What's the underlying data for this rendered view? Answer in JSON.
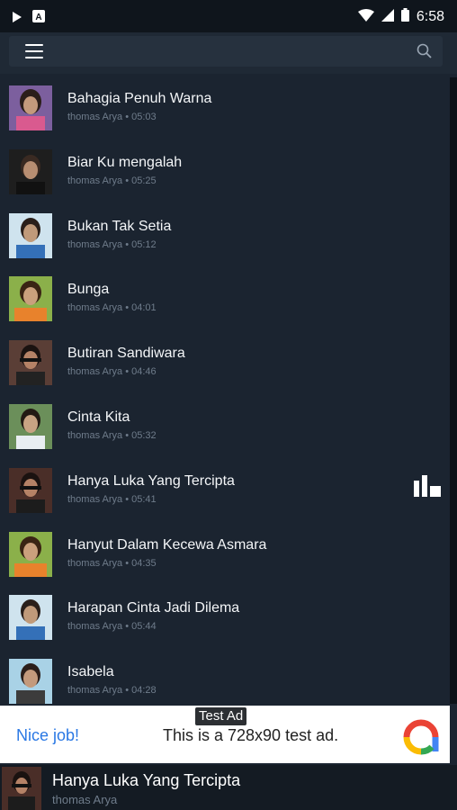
{
  "status_bar": {
    "time": "6:58",
    "left_icons": [
      "play-icon",
      "a-app-icon"
    ],
    "right_icons": [
      "wifi-icon",
      "signal-icon",
      "battery-icon"
    ]
  },
  "app_bar": {
    "menu_icon": "hamburger-menu-icon",
    "search_icon": "search-icon"
  },
  "songs": [
    {
      "title": "Bahagia Penuh Warna",
      "subtitle": "thomas Arya • 05:03",
      "playing": false
    },
    {
      "title": "Biar Ku mengalah",
      "subtitle": "thomas Arya • 05:25",
      "playing": false
    },
    {
      "title": "Bukan Tak Setia",
      "subtitle": "thomas Arya • 05:12",
      "playing": false
    },
    {
      "title": "Bunga",
      "subtitle": "thomas Arya • 04:01",
      "playing": false
    },
    {
      "title": "Butiran Sandiwara",
      "subtitle": "thomas Arya • 04:46",
      "playing": false
    },
    {
      "title": "Cinta Kita",
      "subtitle": "thomas Arya • 05:32",
      "playing": false
    },
    {
      "title": "Hanya Luka Yang Tercipta",
      "subtitle": "thomas Arya • 05:41",
      "playing": true
    },
    {
      "title": "Hanyut Dalam Kecewa Asmara",
      "subtitle": "thomas Arya • 04:35",
      "playing": false
    },
    {
      "title": "Harapan Cinta Jadi Dilema",
      "subtitle": "thomas Arya • 05:44",
      "playing": false
    },
    {
      "title": "Isabela",
      "subtitle": "thomas Arya • 04:28",
      "playing": false
    }
  ],
  "ad": {
    "label": "Test Ad",
    "cta": "Nice job!",
    "text": "This is a 728x90 test ad."
  },
  "now_playing": {
    "title": "Hanya Luka Yang Tercipta",
    "artist": "thomas Arya"
  },
  "colors": {
    "background": "#1b2430",
    "app_bar": "#1f2935",
    "accent_blue": "#2a78e4"
  }
}
